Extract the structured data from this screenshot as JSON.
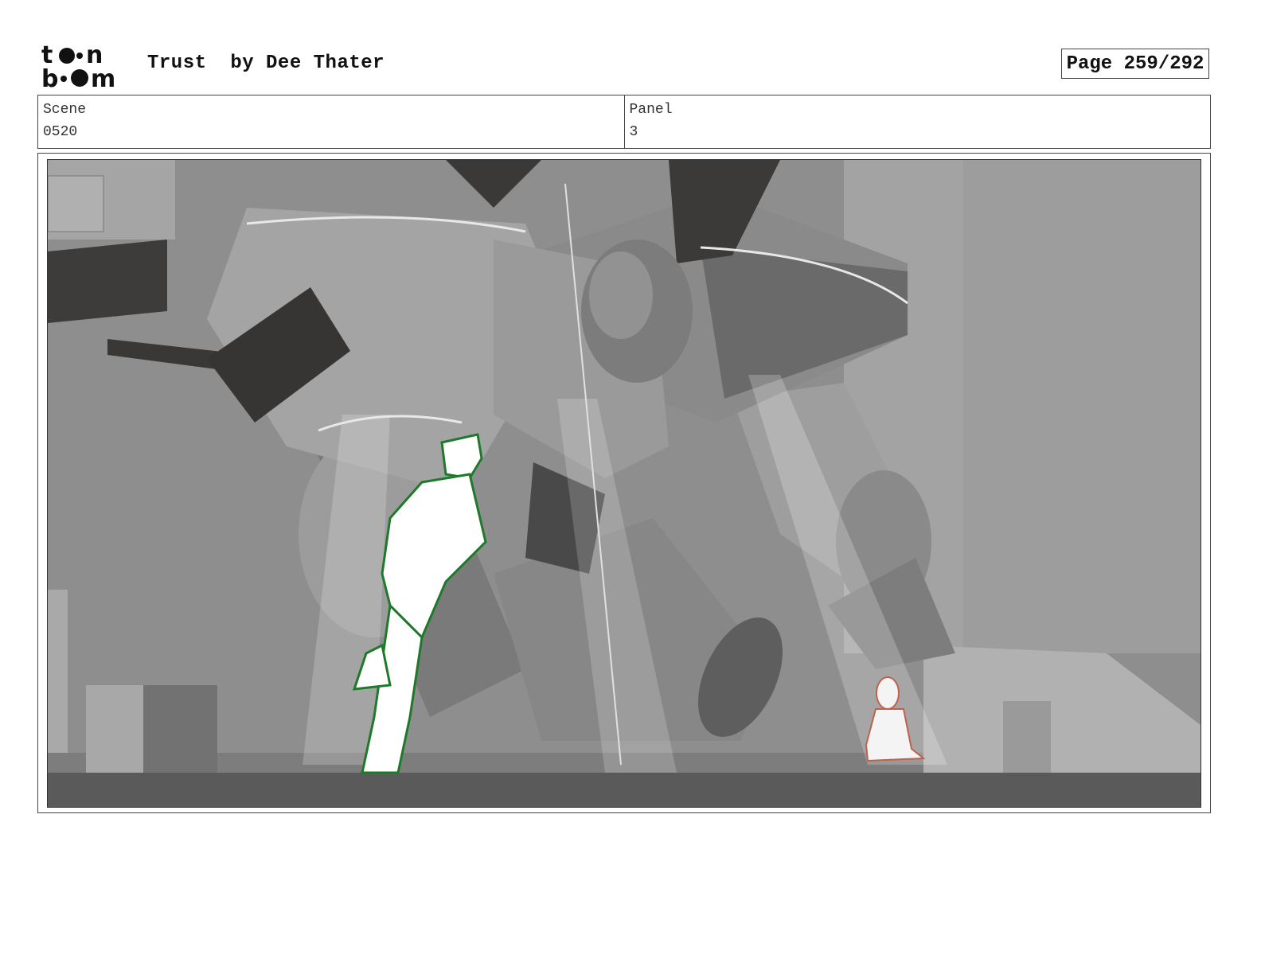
{
  "header": {
    "logo_text": "toon boom",
    "title": "Trust  by Dee Thater",
    "page_label": "Page 259/292"
  },
  "info": {
    "scene_label": "Scene",
    "scene_value": "0520",
    "panel_label": "Panel",
    "panel_value": "3"
  },
  "panel": {
    "colors": {
      "background": "#8c8c8c",
      "figure_boy": "#1e7a2a",
      "figure_girl": "#c0604e"
    }
  }
}
